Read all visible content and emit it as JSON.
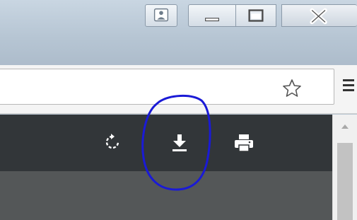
{
  "window": {
    "caption_buttons": {
      "profile_icon": "user-profile-icon",
      "minimize_icon": "minimize-icon",
      "maximize_icon": "maximize-icon",
      "close_icon": "close-icon"
    }
  },
  "toolbar": {
    "address_value": "",
    "bookmark_icon": "star-icon",
    "menu_icon": "hamburger-menu-icon"
  },
  "viewer": {
    "tools": [
      {
        "name": "rotate",
        "icon": "rotate-icon"
      },
      {
        "name": "download",
        "icon": "download-icon"
      },
      {
        "name": "print",
        "icon": "print-icon"
      }
    ]
  },
  "colors": {
    "viewer_toolbar": "#323639",
    "content_background": "#545758",
    "annotation": "#1a1ad6"
  }
}
